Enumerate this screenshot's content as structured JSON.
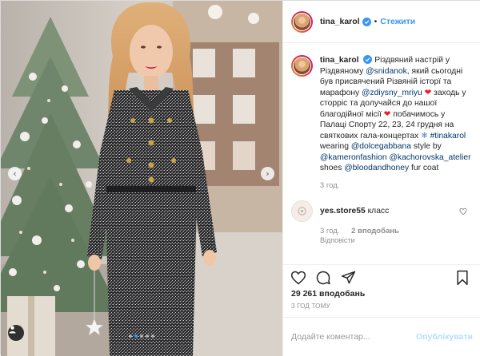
{
  "header": {
    "username": "tina_karol",
    "separator": "•",
    "follow_label": "Стежити"
  },
  "caption": {
    "username": "tina_karol",
    "t1": "Різдвяний настрій у Різдвяному ",
    "m1": "@snidanok",
    "t2": ", який сьогодні був присвячений Різвяній історї та марафону ",
    "m2": "@zdiysny_mriyu",
    "heart": "❤",
    "t3": " заходь у сторріс та долучайся до нашої благодійної місії ",
    "t4": " побачимось у Палаці Спорту 22, 23, 24 грудня на святкових гала-концертах ",
    "flake": "❄",
    "h1": "#tinakarol",
    "t5": " wearing ",
    "m3": "@dolcegabbana",
    "t6": " style by ",
    "m4": "@kameronfashion",
    "m5": "@kachorovska_atelier",
    "t7": " shoes ",
    "m6": "@bloodandhoney",
    "t8": " fur coat",
    "time": "3 год."
  },
  "reply": {
    "username": "yes.store55",
    "text": "класс",
    "time": "3 год.",
    "likes": "2 вподобань",
    "reply_label": "Відповісти"
  },
  "stats": {
    "likes": "29 261 вподобань",
    "posted": "3 ГОД ТОМУ"
  },
  "comment_box": {
    "placeholder": "Додайте коментар...",
    "post_label": "Опублікувати"
  },
  "carousel": {
    "count": 5,
    "active_index": 1,
    "prev_glyph": "‹",
    "next_glyph": "›"
  },
  "icons": {
    "verified": "verified-badge-icon",
    "like": "heart-outline-icon",
    "comment": "speech-bubble-icon",
    "share": "paper-plane-icon",
    "save": "bookmark-icon",
    "tag": "person-tag-icon"
  },
  "colors": {
    "link": "#00376b",
    "accent": "#3897f0",
    "muted": "#8e8e8e",
    "heart": "#ed1d25"
  }
}
